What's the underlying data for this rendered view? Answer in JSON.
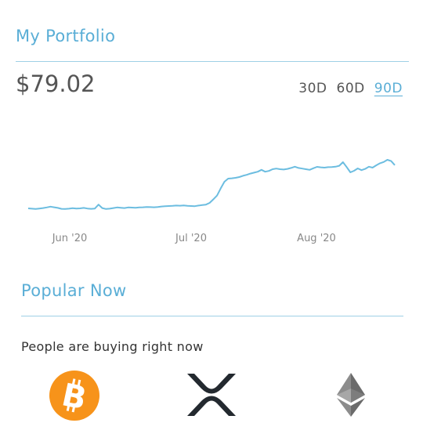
{
  "portfolio": {
    "title": "My Portfolio",
    "balance": "$79.02",
    "ranges": [
      "30D",
      "60D",
      "90D"
    ],
    "active_range": "90D"
  },
  "chart_data": {
    "type": "line",
    "x_tick_labels": [
      "Jun '20",
      "Jul '20",
      "Aug '20"
    ],
    "series_color": "#6cbde0",
    "y": [
      12,
      11.8,
      11.6,
      11.9,
      12.2,
      12.6,
      13.1,
      12.7,
      12.3,
      11.7,
      11.6,
      11.8,
      12.1,
      11.9,
      12.0,
      12.3,
      11.9,
      11.7,
      11.9,
      14.4,
      12.2,
      11.6,
      11.8,
      12.2,
      12.6,
      12.4,
      12.2,
      12.6,
      12.5,
      12.4,
      12.6,
      12.7,
      12.9,
      12.8,
      12.7,
      12.9,
      13.2,
      13.4,
      13.5,
      13.6,
      13.8,
      13.7,
      13.9,
      13.6,
      13.5,
      13.4,
      13.8,
      14.1,
      14.4,
      15.5,
      17.8,
      20.2,
      24.8,
      29.0,
      31.0,
      31.2,
      31.5,
      32.0,
      32.8,
      33.4,
      34.2,
      34.8,
      35.4,
      36.6,
      35.4,
      35.9,
      37.0,
      37.4,
      37.0,
      36.8,
      37.2,
      37.8,
      38.6,
      37.8,
      37.4,
      37.0,
      36.6,
      37.6,
      38.5,
      38.2,
      38.0,
      38.3,
      38.4,
      38.6,
      39.2,
      41.5,
      38.4,
      35.0,
      36.0,
      37.5,
      36.4,
      37.2,
      38.6,
      38.0,
      39.5,
      40.8,
      41.6,
      43.0,
      42.2,
      39.6
    ],
    "ylim": [
      0,
      50
    ]
  },
  "popular": {
    "title": "Popular Now",
    "subtitle": "People are buying right now",
    "coins": [
      {
        "icon": "bitcoin-icon",
        "color": "#f7931a"
      },
      {
        "icon": "xrp-icon",
        "color": "#23292f"
      },
      {
        "icon": "ethereum-icon",
        "color": "#8c8c8c"
      }
    ]
  }
}
